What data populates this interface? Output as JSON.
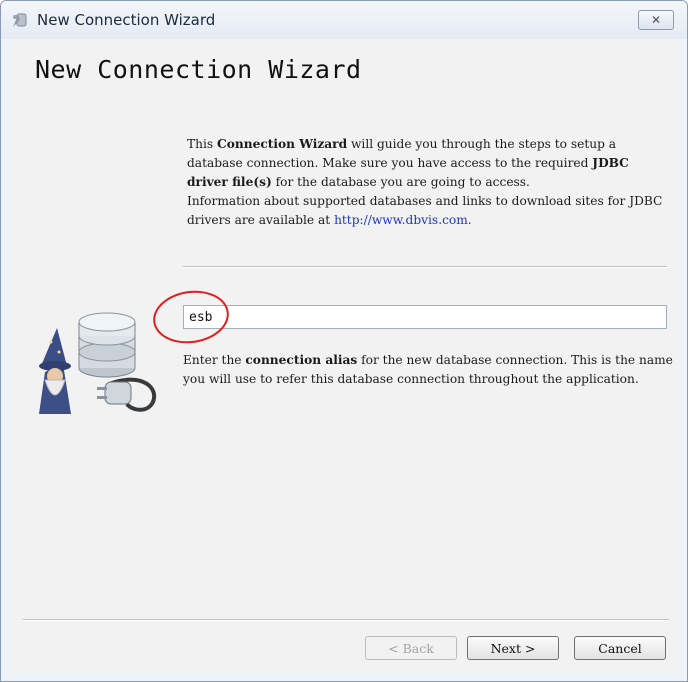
{
  "window": {
    "title": "New Connection Wizard",
    "close_glyph": "✕"
  },
  "wizard": {
    "heading": "New Connection Wizard",
    "intro": {
      "p1_a": "This ",
      "p1_b": "Connection Wizard",
      "p1_c": " will guide you through the steps to setup a database connection. Make sure you have access to the required ",
      "p1_d": "JDBC driver file(s)",
      "p1_e": " for the database you are going to access.",
      "p2_a": "Information about supported databases and links to download sites for JDBC drivers are available at ",
      "p2_link": "http://www.dbvis.com",
      "p2_end": "."
    },
    "alias": {
      "value": "esb"
    },
    "alias_help": {
      "a": "Enter the ",
      "b": "connection alias",
      "c": " for the new database connection. This is the name you will use to refer this database connection throughout the application."
    }
  },
  "buttons": {
    "back": "< Back",
    "next": "Next >",
    "cancel": "Cancel"
  },
  "icons": [
    "app-wizard-icon",
    "close-icon",
    "wizard-database-illustration"
  ],
  "colors": {
    "annotation": "#e01e1e",
    "link": "#1a35c8"
  }
}
